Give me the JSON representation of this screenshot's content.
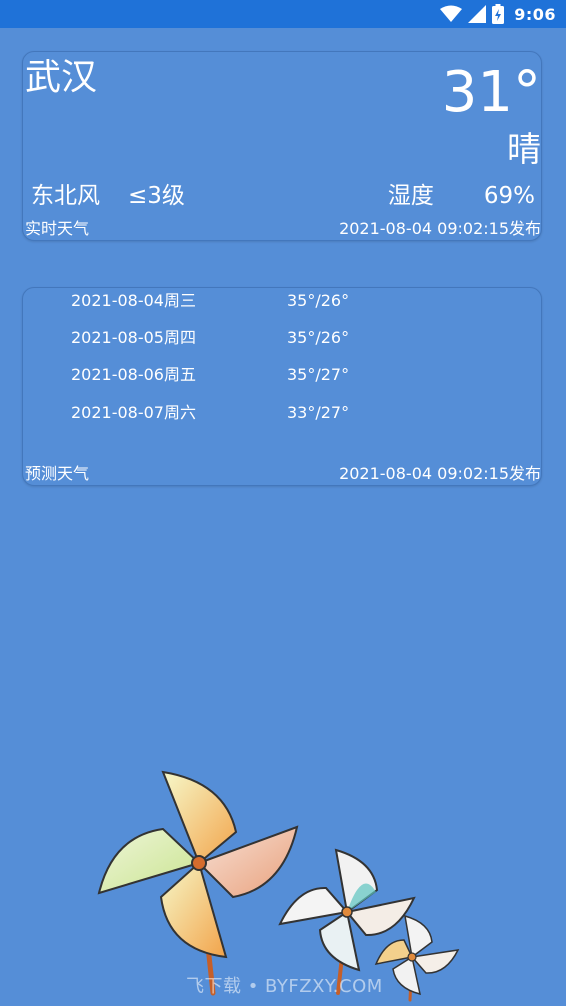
{
  "status_bar": {
    "time": "9:06",
    "icons": [
      "wifi-icon",
      "signal-icon",
      "battery-charging-icon"
    ]
  },
  "current": {
    "city": "武汉",
    "temperature": "31°",
    "condition": "晴",
    "wind_direction": "东北风",
    "wind_level": "≤3级",
    "humidity_label": "湿度",
    "humidity_value": "69%",
    "footer_label": "实时天气",
    "published": "2021-08-04 09:02:15发布"
  },
  "forecast": {
    "days": [
      {
        "date": "2021-08-04",
        "weekday": "周三",
        "temp": "35°/26°"
      },
      {
        "date": "2021-08-05",
        "weekday": "周四",
        "temp": "35°/26°"
      },
      {
        "date": "2021-08-06",
        "weekday": "周五",
        "temp": "35°/27°"
      },
      {
        "date": "2021-08-07",
        "weekday": "周六",
        "temp": "33°/27°"
      }
    ],
    "footer_label": "预测天气",
    "published": "2021-08-04 09:02:15发布"
  },
  "watermark": "飞下载 • BYFZXY.COM",
  "colors": {
    "background": "#558ed7",
    "status_bar": "#1f72d8",
    "text": "#ffffff"
  }
}
